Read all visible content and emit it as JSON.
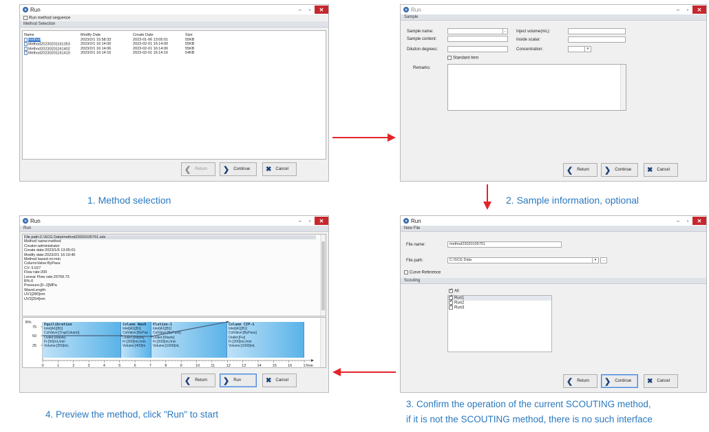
{
  "step1": {
    "window_title": "Run",
    "run_sequence_label": "Run method sequence",
    "section_title": "Method Selection",
    "columns": [
      "Name",
      "Modify Date",
      "Create Date",
      "Size"
    ],
    "rows": [
      {
        "name": "method",
        "modify": "2023/2/1 15:58:33",
        "create": "2023-01-06 13:05:01",
        "size": "55KB"
      },
      {
        "name": "Method20230201161353",
        "modify": "2023/2/1 16:14:00",
        "create": "2023-02-01 16:14:00",
        "size": "55KB"
      },
      {
        "name": "Method20230201161402",
        "modify": "2023/2/1 16:14:06",
        "create": "2023-02-01 16:14:06",
        "size": "55KB"
      },
      {
        "name": "Method20230201161410",
        "modify": "2023/2/1 16:14:16",
        "create": "2023-02-01 16:14:16",
        "size": "54KB"
      }
    ],
    "buttons": {
      "return": "Return",
      "continue": "Continue",
      "cancel": "Cancel"
    }
  },
  "step2": {
    "window_title": "Run",
    "section_title": "Sample",
    "labels": {
      "sample_name": "Sample name:",
      "sample_content": "Sample content:",
      "dilution": "Dilution degrees:",
      "inject_volume": "Inject volume(mL):",
      "inside_scalar": "Inside scalar:",
      "concentration": "Concentration:",
      "standard_item": "Standard item",
      "remarks": "Remarks:"
    },
    "buttons": {
      "return": "Return",
      "continue": "Continue",
      "cancel": "Cancel"
    }
  },
  "step3": {
    "window_title": "Run",
    "section_new_file": "New File",
    "file_name_label": "File name:",
    "file_name_value": "method23020105751",
    "file_path_label": "File path:",
    "file_path_value": "C:\\SCG Data",
    "browse_label": "...",
    "curve_reference_label": "Curve Reference",
    "section_scouting": "Scouting",
    "all_label": "All",
    "runs": [
      "Run1",
      "Run2",
      "Run3"
    ],
    "buttons": {
      "return": "Return",
      "continue": "Continue",
      "cancel": "Cancel"
    }
  },
  "step4": {
    "window_title": "Run",
    "section_title": "Run",
    "info_lines": [
      "File path:C:\\SCG Data\\method23020105751.sdz",
      "Method name:method",
      "Creator:administrator",
      "Create date:2023/1/6 13:05:01",
      "Modify date:2023/2/1 16:19:40",
      "Method based on:min",
      "ColumnValve:ByPass",
      "CV: 5.027",
      "Flow rate:200",
      "Lenear Flow rate:25769.73",
      "B%:0",
      "Pressure:[0--2]MPa",
      "WaveLength:",
      "UV1[280]nm",
      "UV2[254]nm"
    ],
    "chart": {
      "y_label": "B%",
      "y_ticks": [
        "75",
        "50",
        "25"
      ],
      "x_ticks": [
        "0",
        "1",
        "2",
        "3",
        "4",
        "5",
        "6",
        "7",
        "8",
        "9",
        "10",
        "11",
        "12",
        "13",
        "14",
        "15",
        "16",
        "17"
      ],
      "x_unit": "min",
      "phases": [
        {
          "title": "Equilibration",
          "lines": [
            "Inlet[A1][B1]",
            "ColValve:[TrapColumn]",
            "Outlet:[Waste]",
            "Fr:[50]mL/min",
            "Volume:[250]mL"
          ]
        },
        {
          "title": "Column Wash",
          "lines": [
            "Inlet[A1][B1]",
            "ColValve:[ByPas",
            "Outlet:[Waste]",
            "Fr:[200]mL/min",
            "Volume:[400]m"
          ]
        },
        {
          "title": "Elution-1",
          "lines": [
            "Inlet[A1][B1]",
            "ColValve:[ByPass]",
            "Outlet:[Waste]",
            "Fr:[200]mL/min",
            "Volume:[1000]mL"
          ]
        },
        {
          "title": "Column CIP-1",
          "lines": [
            "Inlet[A1][B1]",
            "ColValve:[ByPass]",
            "Outlet:[Fw]",
            "Fr:[200]mL/min",
            "Volume:[1000]mL"
          ]
        }
      ]
    },
    "buttons": {
      "return": "Return",
      "run": "Run",
      "cancel": "Cancel"
    }
  },
  "captions": {
    "c1": "1. Method selection",
    "c2": "2. Sample information, optional",
    "c3a": "3. Confirm the operation of the current SCOUTING method,",
    "c3b": "if it is not the SCOUTING method, there is no such interface",
    "c4": "4. Preview the method, click \"Run\"  to start"
  },
  "colors": {
    "accent": "#2a79bf",
    "arrow": "#e2242a",
    "selection": "#2f74d0",
    "close": "#c7272c"
  }
}
